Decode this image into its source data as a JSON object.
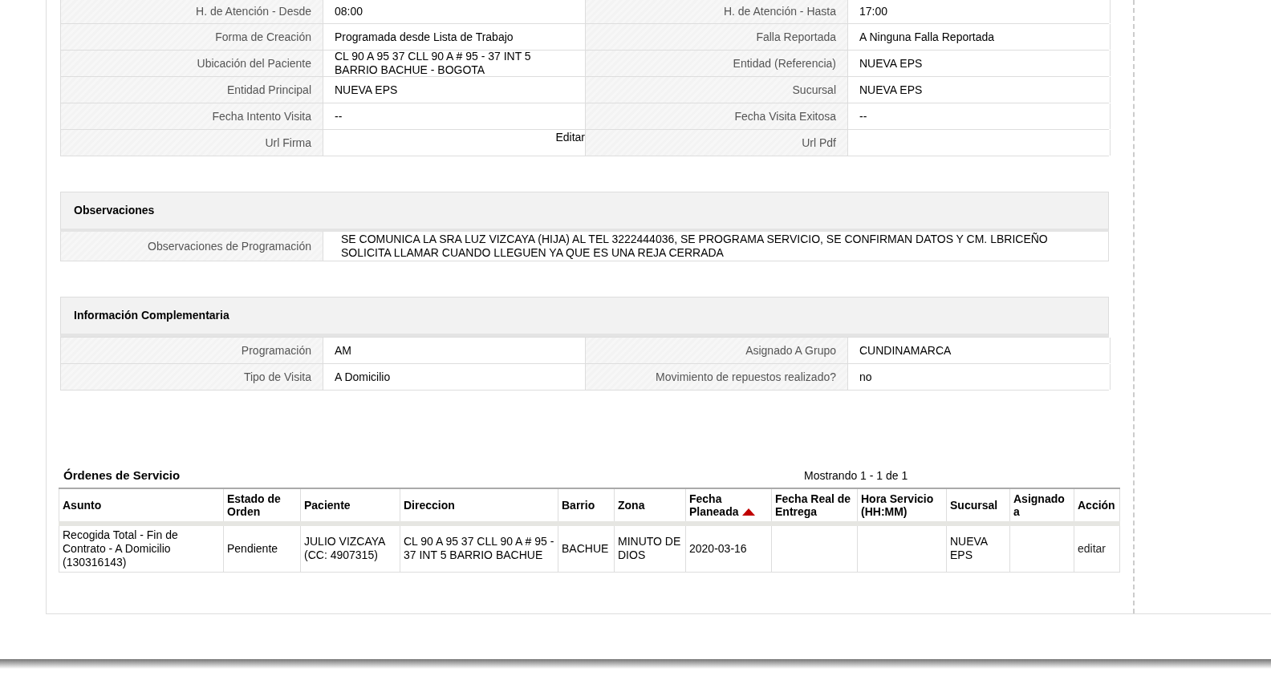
{
  "details": {
    "rows": [
      [
        {
          "label": "H. de Atención - Desde",
          "value": "08:00"
        },
        {
          "label": "H. de Atención - Hasta",
          "value": "17:00"
        }
      ],
      [
        {
          "label": "Forma de Creación",
          "value": "Programada desde Lista de Trabajo"
        },
        {
          "label": "Falla Reportada",
          "value": "A Ninguna Falla Reportada"
        }
      ],
      [
        {
          "label": "Ubicación del Paciente",
          "value": "CL 90 A 95 37 CLL 90 A # 95 - 37 INT 5 BARRIO BACHUE - BOGOTA"
        },
        {
          "label": "Entidad (Referencia)",
          "value": "NUEVA EPS"
        }
      ],
      [
        {
          "label": "Entidad Principal",
          "value": "NUEVA EPS"
        },
        {
          "label": "Sucursal",
          "value": "NUEVA EPS"
        }
      ],
      [
        {
          "label": "Fecha Intento Visita",
          "value": "--"
        },
        {
          "label": "Fecha Visita Exitosa",
          "value": "--"
        }
      ],
      [
        {
          "label": "Url Firma",
          "action": "Editar"
        },
        {
          "label": "Url Pdf"
        }
      ]
    ]
  },
  "observations": {
    "title": "Observaciones",
    "label": "Observaciones de Programación",
    "value": "SE COMUNICA LA SRA LUZ VIZCAYA (HIJA) AL TEL 3222444036, SE PROGRAMA SERVICIO, SE CONFIRMAN DATOS Y CM. LBRICEÑO SOLICITA LLAMAR CUANDO LLEGUEN YA QUE ES UNA REJA CERRADA"
  },
  "complementary": {
    "title": "Información Complementaria",
    "rows": [
      [
        {
          "label": "Programación",
          "value": "AM"
        },
        {
          "label": "Asignado A Grupo",
          "value": "CUNDINAMARCA"
        }
      ],
      [
        {
          "label": "Tipo de Visita",
          "value": "A Domicilio"
        },
        {
          "label": "Movimiento de repuestos realizado?",
          "value": "no"
        }
      ]
    ]
  },
  "orders": {
    "title": "Órdenes de Servicio",
    "paging": "Mostrando 1 - 1 de 1",
    "columns": [
      {
        "label": "Asunto",
        "sorted": false
      },
      {
        "label": "Estado de Orden",
        "sorted": false
      },
      {
        "label": "Paciente",
        "sorted": false
      },
      {
        "label": "Direccion",
        "sorted": false
      },
      {
        "label": "Barrio",
        "sorted": false
      },
      {
        "label": "Zona",
        "sorted": false
      },
      {
        "label": "Fecha Planeada",
        "sorted": true
      },
      {
        "label": "Fecha Real de Entrega",
        "sorted": false
      },
      {
        "label": "Hora Servicio (HH:MM)",
        "sorted": false
      },
      {
        "label": "Sucursal",
        "sorted": false
      },
      {
        "label": "Asignado a",
        "sorted": false
      },
      {
        "label": "Acción",
        "sorted": false
      }
    ],
    "rows": [
      {
        "cells": [
          "Recogida Total - Fin de Contrato - A Domicilio (130316143)",
          "Pendiente",
          "JULIO VIZCAYA (CC: 4907315)",
          "CL 90 A 95 37 CLL 90 A # 95 - 37 INT 5 BARRIO BACHUE",
          "BACHUE",
          "MINUTO DE DIOS",
          "2020-03-16",
          "",
          "",
          "NUEVA EPS",
          ""
        ],
        "action": "editar"
      }
    ]
  }
}
